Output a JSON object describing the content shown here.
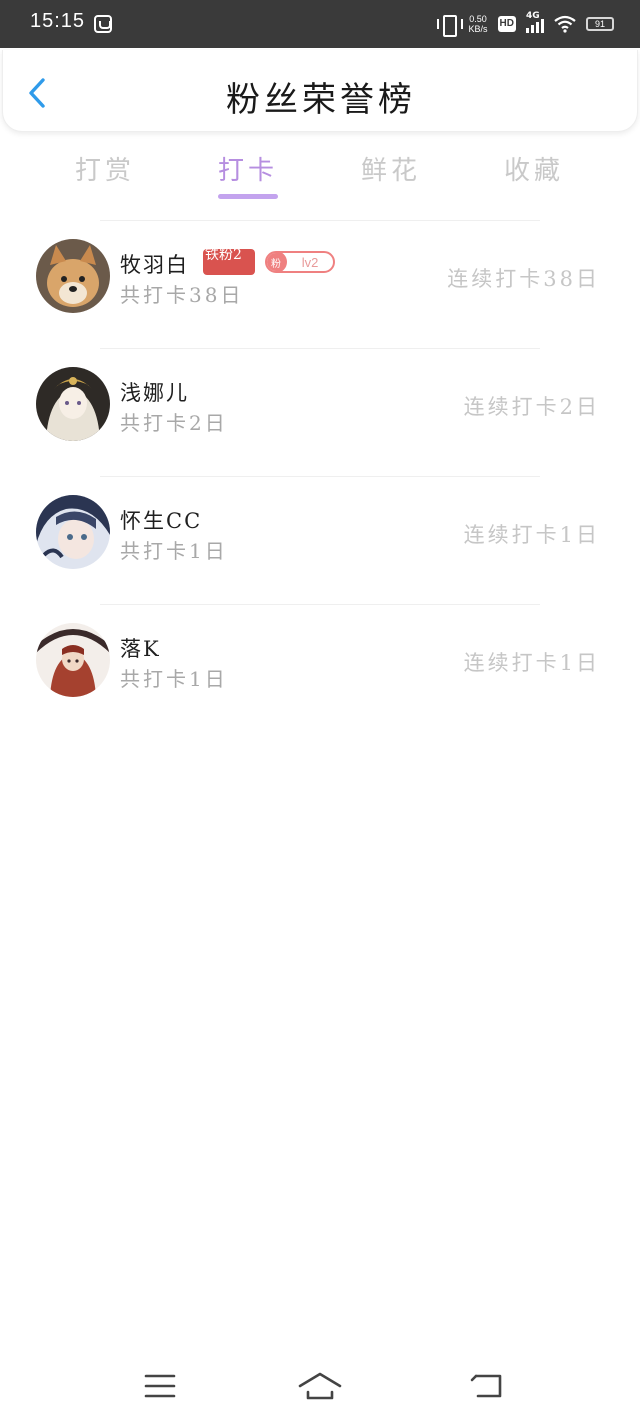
{
  "status_bar": {
    "time": "15:15",
    "net_speed_value": "0.50",
    "net_speed_unit": "KB/s",
    "hd_label": "HD",
    "network_label": "4G",
    "battery_level": "91"
  },
  "header": {
    "title": "粉丝荣誉榜"
  },
  "tabs": [
    {
      "label": "打赏"
    },
    {
      "label": "打卡"
    },
    {
      "label": "鲜花"
    },
    {
      "label": "收藏"
    }
  ],
  "active_tab": "打卡",
  "colors": {
    "accent": "#b68ee0",
    "indicator": "#c3a3ee",
    "back_icon": "#2f9bea",
    "fan_badge": "#d9534f",
    "level_pill": "#ef8080",
    "status_bar_bg": "#3a3a3a"
  },
  "list": [
    {
      "name": "牧羽白",
      "total": "共打卡38日",
      "streak": "连续打卡38日",
      "fan_badge": "铁粉2",
      "level_icon": "粉",
      "level": "lv2"
    },
    {
      "name": "浅娜儿",
      "total": "共打卡2日",
      "streak": "连续打卡2日"
    },
    {
      "name": "怀生CC",
      "total": "共打卡1日",
      "streak": "连续打卡1日"
    },
    {
      "name": "落K",
      "total": "共打卡1日",
      "streak": "连续打卡1日"
    }
  ],
  "nav_bar": {
    "menu_icon": "menu-icon",
    "home_icon": "home-icon",
    "back_icon": "back-nav-icon"
  }
}
